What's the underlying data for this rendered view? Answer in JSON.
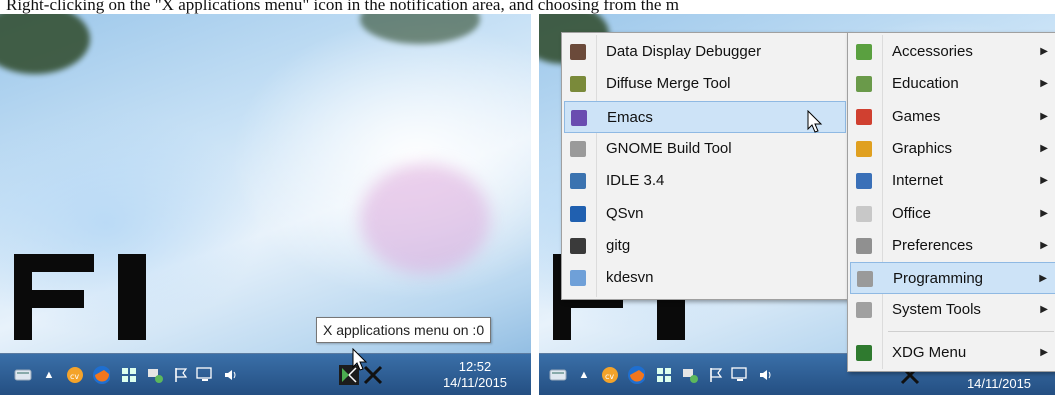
{
  "caption": "Right-clicking on the \"X applications menu\" icon in the notification area, and choosing from the m",
  "left_panel": {
    "tooltip": "X applications menu on :0",
    "clock_time": "12:52",
    "clock_date": "14/11/2015"
  },
  "right_panel": {
    "clock_date": "14/11/2015",
    "submenu": [
      {
        "label": "Data Display Debugger",
        "icon": "ddd-icon",
        "color": "#6b4a3a"
      },
      {
        "label": "Diffuse Merge Tool",
        "icon": "diffuse-icon",
        "color": "#7a8a3a"
      },
      {
        "label": "Emacs",
        "icon": "emacs-icon",
        "color": "#6a4cb0"
      },
      {
        "label": "GNOME Build Tool",
        "icon": "gnome-build-icon",
        "color": "#9a9a9a"
      },
      {
        "label": "IDLE 3.4",
        "icon": "python-icon",
        "color": "#3b73b0"
      },
      {
        "label": "QSvn",
        "icon": "qsvn-icon",
        "color": "#2060b0"
      },
      {
        "label": "gitg",
        "icon": "gitg-icon",
        "color": "#3a3a3a"
      },
      {
        "label": "kdesvn",
        "icon": "kdesvn-icon",
        "color": "#6fa0d8"
      }
    ],
    "main_menu": [
      {
        "label": "Accessories",
        "icon": "accessories-icon",
        "color": "#5aa040"
      },
      {
        "label": "Education",
        "icon": "education-icon",
        "color": "#6a9a4a"
      },
      {
        "label": "Games",
        "icon": "games-icon",
        "color": "#d04030"
      },
      {
        "label": "Graphics",
        "icon": "graphics-icon",
        "color": "#e0a020"
      },
      {
        "label": "Internet",
        "icon": "internet-icon",
        "color": "#3a70b8"
      },
      {
        "label": "Office",
        "icon": "office-icon",
        "color": "#c8c8c8"
      },
      {
        "label": "Preferences",
        "icon": "preferences-icon",
        "color": "#909090"
      },
      {
        "label": "Programming",
        "icon": "programming-icon",
        "color": "#9a9a9a"
      },
      {
        "label": "System Tools",
        "icon": "system-tools-icon",
        "color": "#a0a0a0"
      },
      {
        "label": "XDG Menu",
        "icon": "xdg-menu-icon",
        "color": "#2f7a2f"
      }
    ],
    "arrow_glyph": "▶",
    "highlight_color": "#cde3f7"
  },
  "taskbar": {
    "color": "#2f5f96",
    "icons": [
      "keyboard-icon",
      "chevron-up-icon",
      "cv-icon",
      "firefox-icon",
      "windows-flag-icon",
      "network-icon",
      "flag-icon",
      "monitor-icon",
      "speaker-icon",
      "xming-icon"
    ]
  }
}
